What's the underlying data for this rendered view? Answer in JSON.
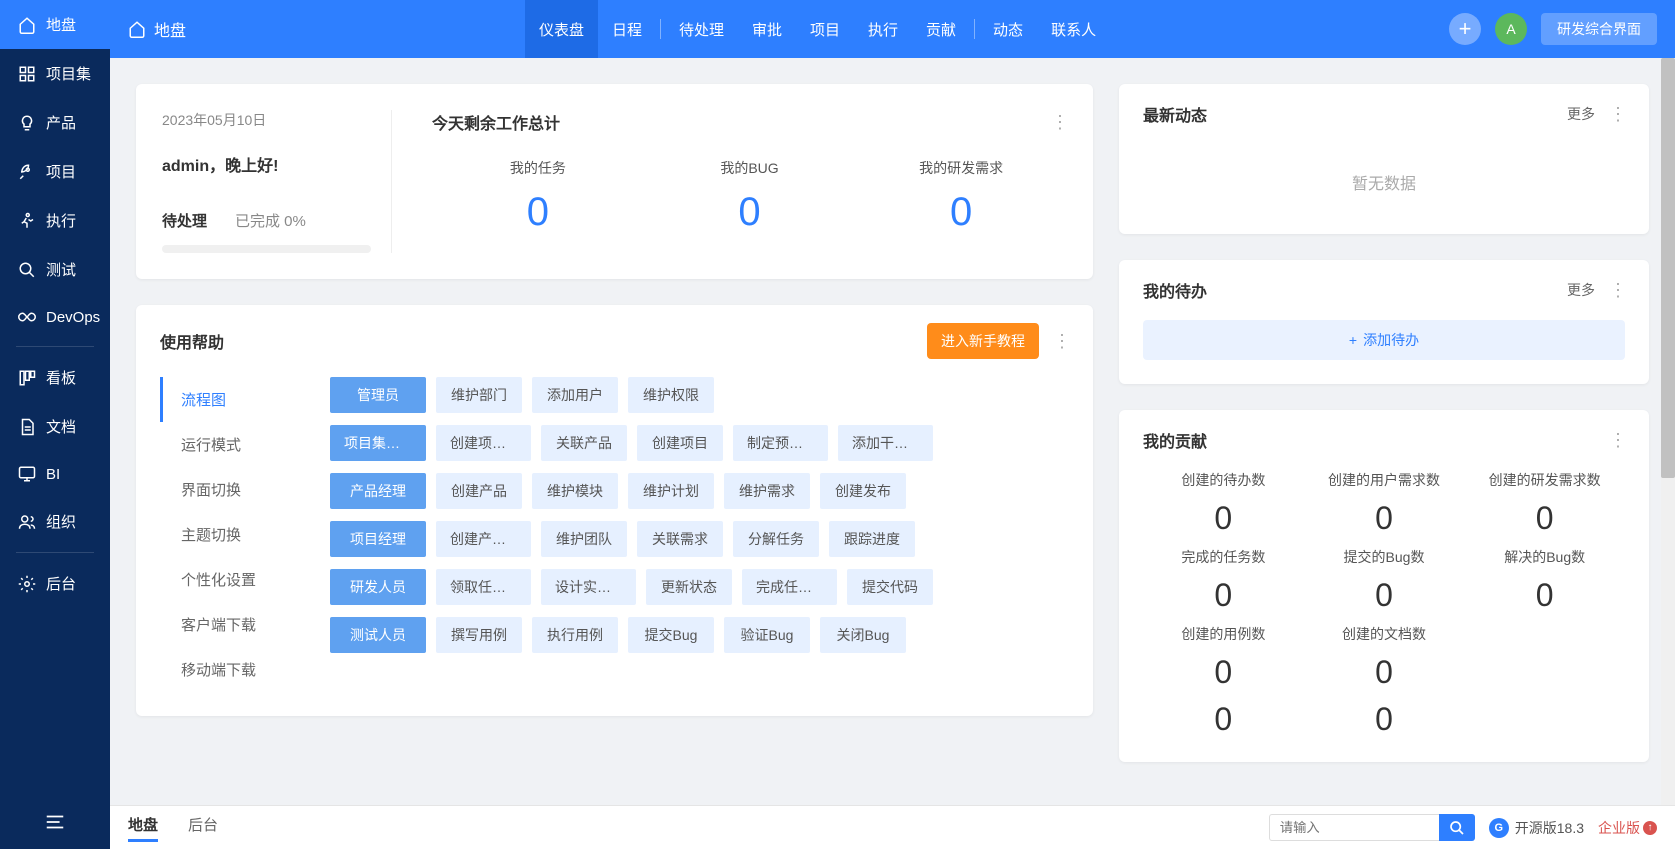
{
  "sidebar": {
    "items": [
      {
        "label": "地盘",
        "icon": "home"
      },
      {
        "label": "项目集",
        "icon": "grid"
      },
      {
        "label": "产品",
        "icon": "bulb"
      },
      {
        "label": "项目",
        "icon": "rocket"
      },
      {
        "label": "执行",
        "icon": "run"
      },
      {
        "label": "测试",
        "icon": "search"
      },
      {
        "label": "DevOps",
        "icon": "infinity"
      },
      {
        "label": "看板",
        "icon": "board"
      },
      {
        "label": "文档",
        "icon": "doc"
      },
      {
        "label": "BI",
        "icon": "monitor"
      },
      {
        "label": "组织",
        "icon": "people"
      },
      {
        "label": "后台",
        "icon": "gear"
      }
    ]
  },
  "topbar": {
    "home_label": "地盘",
    "nav": [
      "仪表盘",
      "日程",
      "待处理",
      "审批",
      "项目",
      "执行",
      "贡献",
      "动态",
      "联系人"
    ],
    "avatar_letter": "A",
    "view_label": "研发综合界面"
  },
  "welcome": {
    "date": "2023年05月10日",
    "greeting": "admin，晚上好!",
    "pending_label": "待处理",
    "done_label": "已完成 0%",
    "summary_title": "今天剩余工作总计",
    "stats": [
      {
        "label": "我的任务",
        "value": "0"
      },
      {
        "label": "我的BUG",
        "value": "0"
      },
      {
        "label": "我的研发需求",
        "value": "0"
      }
    ]
  },
  "help": {
    "title": "使用帮助",
    "tutorial_btn": "进入新手教程",
    "tabs": [
      "流程图",
      "运行模式",
      "界面切换",
      "主题切换",
      "个性化设置",
      "客户端下载",
      "移动端下载"
    ],
    "flows": [
      {
        "head": "管理员",
        "steps": [
          "维护部门",
          "添加用户",
          "维护权限"
        ]
      },
      {
        "head": "项目集负责人",
        "steps": [
          "创建项目集",
          "关联产品",
          "创建项目",
          "制定预算和规",
          "添加干系人"
        ]
      },
      {
        "head": "产品经理",
        "steps": [
          "创建产品",
          "维护模块",
          "维护计划",
          "维护需求",
          "创建发布"
        ]
      },
      {
        "head": "项目经理",
        "steps": [
          "创建产品、执",
          "维护团队",
          "关联需求",
          "分解任务",
          "跟踪进度"
        ]
      },
      {
        "head": "研发人员",
        "steps": [
          "领取任务和Bu",
          "设计实现方案",
          "更新状态",
          "完成任务和Bu",
          "提交代码"
        ]
      },
      {
        "head": "测试人员",
        "steps": [
          "撰写用例",
          "执行用例",
          "提交Bug",
          "验证Bug",
          "关闭Bug"
        ]
      }
    ]
  },
  "latest": {
    "title": "最新动态",
    "more": "更多",
    "empty": "暂无数据"
  },
  "todo": {
    "title": "我的待办",
    "more": "更多",
    "add_label": "添加待办"
  },
  "contrib": {
    "title": "我的贡献",
    "items": [
      {
        "label": "创建的待办数",
        "value": "0"
      },
      {
        "label": "创建的用户需求数",
        "value": "0"
      },
      {
        "label": "创建的研发需求数",
        "value": "0"
      },
      {
        "label": "完成的任务数",
        "value": "0"
      },
      {
        "label": "提交的Bug数",
        "value": "0"
      },
      {
        "label": "解决的Bug数",
        "value": "0"
      },
      {
        "label": "创建的用例数",
        "value": "0"
      },
      {
        "label": "创建的文档数",
        "value": "0"
      },
      {
        "label": "",
        "value": ""
      },
      {
        "label": "",
        "value": "0"
      },
      {
        "label": "",
        "value": "0"
      },
      {
        "label": "",
        "value": ""
      }
    ]
  },
  "footer": {
    "tabs": [
      "地盘",
      "后台"
    ],
    "search_placeholder": "请输入",
    "version": "开源版18.3",
    "enterprise": "企业版"
  }
}
